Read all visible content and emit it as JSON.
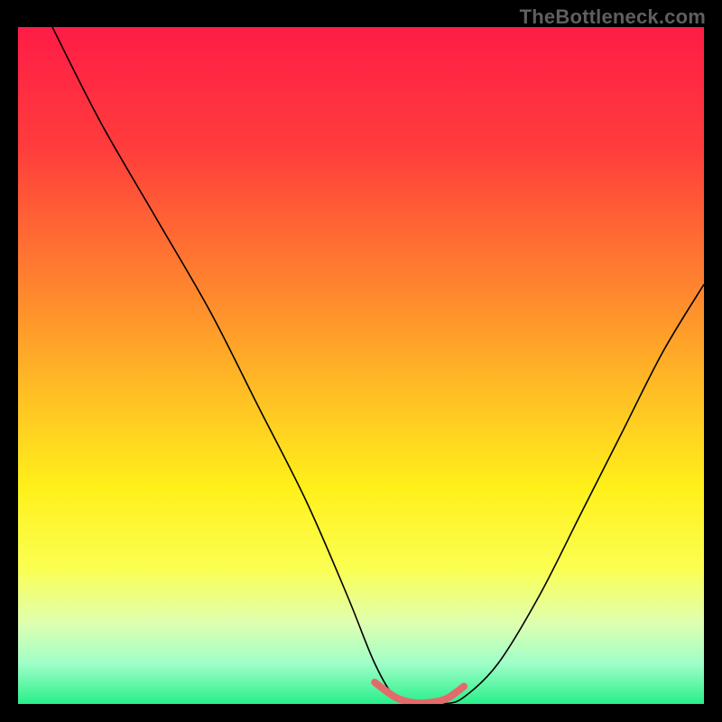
{
  "watermark": "TheBottleneck.com",
  "chart_data": {
    "type": "line",
    "title": "",
    "xlabel": "",
    "ylabel": "",
    "xlim": [
      0,
      100
    ],
    "ylim": [
      0,
      100
    ],
    "background_gradient": {
      "stops": [
        {
          "offset": 0,
          "color": "#ff1c46"
        },
        {
          "offset": 18,
          "color": "#ff3d3c"
        },
        {
          "offset": 40,
          "color": "#ff8a2d"
        },
        {
          "offset": 55,
          "color": "#ffc224"
        },
        {
          "offset": 68,
          "color": "#fff01a"
        },
        {
          "offset": 80,
          "color": "#fbff52"
        },
        {
          "offset": 88,
          "color": "#dfffb0"
        },
        {
          "offset": 94,
          "color": "#9fffc8"
        },
        {
          "offset": 100,
          "color": "#28ef8b"
        }
      ]
    },
    "series": [
      {
        "name": "bottleneck-curve",
        "color": "#000000",
        "width": 1.6,
        "x": [
          5,
          12,
          20,
          28,
          35,
          42,
          48,
          52,
          55,
          58,
          62,
          65,
          70,
          76,
          82,
          88,
          94,
          100
        ],
        "y": [
          100,
          86,
          72,
          58,
          44,
          30,
          16,
          6,
          1,
          0,
          0,
          1,
          6,
          16,
          28,
          40,
          52,
          62
        ]
      }
    ],
    "highlight_segment": {
      "name": "trough",
      "color": "#e36a6a",
      "width": 8,
      "x": [
        52,
        55,
        57.5,
        60,
        62.5,
        65
      ],
      "y": [
        3.2,
        1.0,
        0.2,
        0.2,
        0.8,
        2.6
      ]
    }
  }
}
